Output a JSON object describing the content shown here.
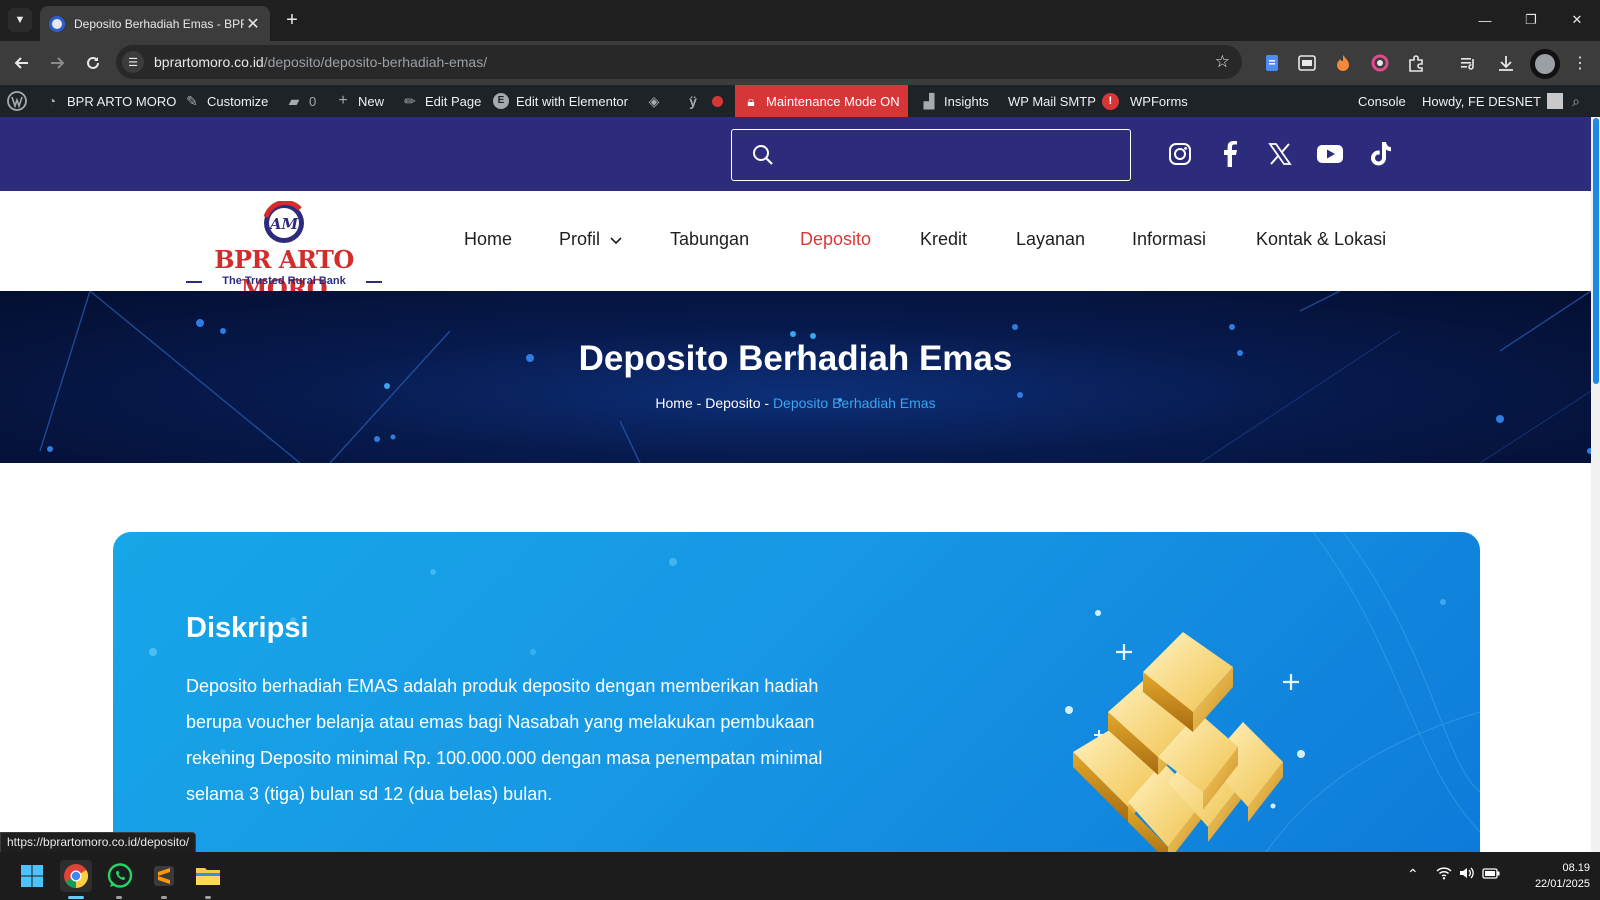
{
  "browser": {
    "tab_title": "Deposito Berhadiah Emas - BPR ARTO MORO",
    "url_host": "bprartomoro.co.id",
    "url_path": "/deposito/deposito-berhadiah-emas/",
    "status_url": "https://bprartomoro.co.id/deposito/"
  },
  "adminbar": {
    "site_name": "BPR ARTO MORO",
    "customize": "Customize",
    "comments_count": "0",
    "new": "New",
    "edit_page": "Edit Page",
    "edit_elementor": "Edit with Elementor",
    "maintenance": "Maintenance Mode ON",
    "insights": "Insights",
    "wp_mail_smtp": "WP Mail SMTP",
    "smtp_badge": "!",
    "wpforms": "WPForms",
    "console": "Console",
    "howdy": "Howdy, FE DESNET"
  },
  "topbar": {
    "search_placeholder": "",
    "social_icons": [
      "instagram-icon",
      "facebook-icon",
      "x-icon",
      "youtube-icon",
      "tiktok-icon"
    ]
  },
  "logo": {
    "name": "BPR ARTO MORO",
    "tagline": "The Trusted Rural Bank"
  },
  "nav": {
    "items": [
      {
        "label": "Home"
      },
      {
        "label": "Profil"
      },
      {
        "label": "Tabungan"
      },
      {
        "label": "Deposito"
      },
      {
        "label": "Kredit"
      },
      {
        "label": "Layanan"
      },
      {
        "label": "Informasi"
      },
      {
        "label": "Kontak & Lokasi"
      }
    ],
    "active_label": "Deposito"
  },
  "hero": {
    "title": "Deposito Berhadiah Emas",
    "breadcrumb": [
      {
        "label": "Home"
      },
      {
        "label": "Deposito"
      },
      {
        "label": "Deposito Berhadiah Emas"
      }
    ],
    "separator": "-"
  },
  "content": {
    "heading": "Diskripsi",
    "body": "Deposito berhadiah EMAS adalah produk deposito dengan memberikan hadiah berupa voucher belanja atau emas bagi Nasabah yang melakukan pembukaan rekening Deposito minimal Rp. 100.000.000 dengan masa penempatan minimal selama 3  (tiga) bulan sd 12 (dua belas) bulan."
  },
  "taskbar": {
    "time": "08.19",
    "date": "22/01/2025",
    "apps": [
      "windows-start-icon",
      "chrome-icon",
      "whatsapp-icon",
      "sublime-text-icon",
      "file-explorer-icon"
    ]
  },
  "colors": {
    "brand_navy": "#2d2c7c",
    "brand_red": "#d42b2b",
    "active_nav": "#d83a3a",
    "card_blue": "#1797e4",
    "breadcrumb_current": "#3aa6f0",
    "maintenance_red": "#d63638"
  }
}
